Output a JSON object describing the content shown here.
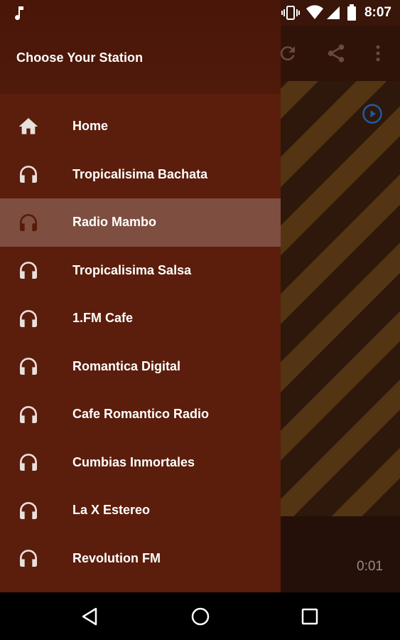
{
  "status_bar": {
    "time": "8:07",
    "icons": [
      "music-note-icon",
      "vibrate-icon",
      "wifi-icon",
      "signal-icon",
      "battery-icon"
    ]
  },
  "drawer": {
    "title": "Choose Your Station",
    "items": [
      {
        "label": "Home",
        "icon": "home-icon",
        "selected": false
      },
      {
        "label": "Tropicalisima Bachata",
        "icon": "headphones-icon",
        "selected": false
      },
      {
        "label": "Radio Mambo",
        "icon": "headphones-icon",
        "selected": true
      },
      {
        "label": "Tropicalisima Salsa",
        "icon": "headphones-icon",
        "selected": false
      },
      {
        "label": "1.FM Cafe",
        "icon": "headphones-icon",
        "selected": false
      },
      {
        "label": "Romantica Digital",
        "icon": "headphones-icon",
        "selected": false
      },
      {
        "label": "Cafe Romantico Radio",
        "icon": "headphones-icon",
        "selected": false
      },
      {
        "label": "Cumbias Inmortales",
        "icon": "headphones-icon",
        "selected": false
      },
      {
        "label": "La X Estereo",
        "icon": "headphones-icon",
        "selected": false
      },
      {
        "label": "Revolution FM",
        "icon": "headphones-icon",
        "selected": false
      }
    ]
  },
  "player": {
    "elapsed": "0:01",
    "toolbar_icons": [
      "refresh-icon",
      "share-icon",
      "more-vert-icon"
    ]
  },
  "navbar": {
    "buttons": [
      "back-icon",
      "home-circle-icon",
      "recents-icon"
    ]
  },
  "colors": {
    "drawer_bg": "#5b1d0c",
    "selected_bg": "#7e4e40",
    "accent_blue": "#1e5aa8"
  }
}
